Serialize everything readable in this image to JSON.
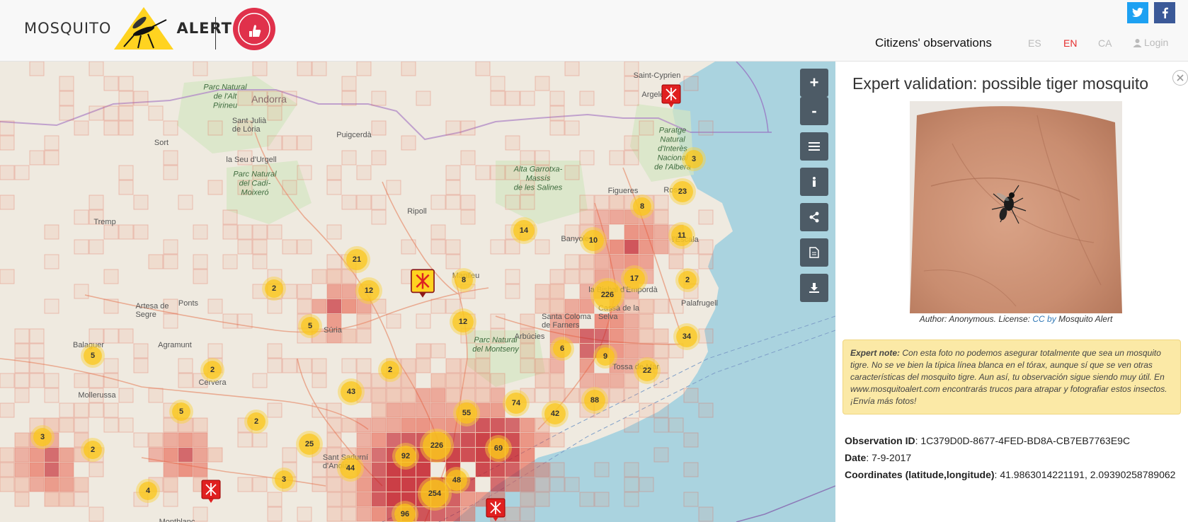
{
  "header": {
    "brand_left": "MOSQUITO",
    "brand_right": "ALERT",
    "nav_title": "Citizens' observations",
    "languages": [
      {
        "code": "ES",
        "active": false
      },
      {
        "code": "EN",
        "active": true
      },
      {
        "code": "CA",
        "active": false
      }
    ],
    "login": "Login",
    "social": {
      "twitter": "twitter-icon",
      "facebook": "facebook-icon"
    }
  },
  "map": {
    "controls": [
      "zoom-in",
      "zoom-out",
      "layers",
      "info",
      "share",
      "report",
      "download"
    ],
    "control_labels": {
      "zoom_in": "+",
      "zoom_out": "-"
    },
    "places": [
      {
        "text": "Andorra",
        "kind": "big"
      },
      {
        "text": "Sant Julià\nde Lòria",
        "kind": "town"
      },
      {
        "text": "Sort",
        "kind": "town"
      },
      {
        "text": "la Seu d'Urgell",
        "kind": "town"
      },
      {
        "text": "Puigcerdà",
        "kind": "town"
      },
      {
        "text": "Tremp",
        "kind": "town"
      },
      {
        "text": "Ripoll",
        "kind": "town"
      },
      {
        "text": "Banyoles",
        "kind": "town"
      },
      {
        "text": "Figueres",
        "kind": "town"
      },
      {
        "text": "Roses",
        "kind": "town"
      },
      {
        "text": "l'Escala",
        "kind": "town"
      },
      {
        "text": "Saint-Cyprien",
        "kind": "town"
      },
      {
        "text": "Argelès",
        "kind": "town"
      },
      {
        "text": "Manlleu",
        "kind": "town"
      },
      {
        "text": "Artesa de\nSegre",
        "kind": "town"
      },
      {
        "text": "Ponts",
        "kind": "town"
      },
      {
        "text": "Súria",
        "kind": "town"
      },
      {
        "text": "Agramunt",
        "kind": "town"
      },
      {
        "text": "Balaguer",
        "kind": "town"
      },
      {
        "text": "Mollerussa",
        "kind": "town"
      },
      {
        "text": "Cervera",
        "kind": "town"
      },
      {
        "text": "Arbúcies",
        "kind": "town"
      },
      {
        "text": "Santa Coloma\nde Farners",
        "kind": "town"
      },
      {
        "text": "la Bisbal d'Empordà",
        "kind": "town"
      },
      {
        "text": "Cassà de la\nSelva",
        "kind": "town"
      },
      {
        "text": "Palafrugell",
        "kind": "town"
      },
      {
        "text": "Tossa de Mar",
        "kind": "town"
      },
      {
        "text": "Sant Sadurní\nd'Anoia",
        "kind": "town"
      },
      {
        "text": "Montblanc",
        "kind": "town"
      },
      {
        "text": "Parc Natural\nde l'Alt\nPirineu",
        "kind": "park"
      },
      {
        "text": "Parc Natural\ndel Cadí-\nMoixeró",
        "kind": "park"
      },
      {
        "text": "Alta Garrotxa-\nMassís\nde les Salines",
        "kind": "park"
      },
      {
        "text": "Paratge\nNatural\nd'Interès\nNacional\nde l'Albera",
        "kind": "park"
      },
      {
        "text": "Parc Natural\ndel Montseny",
        "kind": "park"
      }
    ],
    "clusters": [
      "3",
      "23",
      "8",
      "11",
      "14",
      "10",
      "21",
      "2",
      "12",
      "8",
      "17",
      "2",
      "226",
      "5",
      "12",
      "34",
      "6",
      "9",
      "2",
      "22",
      "5",
      "2",
      "43",
      "88",
      "74",
      "42",
      "5",
      "55",
      "2",
      "3",
      "2",
      "25",
      "226",
      "92",
      "69",
      "44",
      "48",
      "3",
      "254",
      "4",
      "96"
    ]
  },
  "panel": {
    "title": "Expert validation: possible tiger mosquito",
    "credit_prefix": "Author: Anonymous. License: ",
    "credit_link": "CC by",
    "credit_suffix": " Mosquito Alert",
    "note_label": "Expert note:",
    "note_text": " Con esta foto no podemos asegurar totalmente que sea un mosquito tigre. No se ve bien la típica línea blanca en el tórax, aunque sí que se ven otras características del mosquito tigre. Aun así, tu observación sigue siendo muy útil. En www.mosquitoalert.com encontrarás trucos para atrapar y fotografiar estos insectos. ¡Envía más fotos!",
    "observation_label": "Observation ID",
    "observation_value": ": 1C379D0D-8677-4FED-BD8A-CB7EB7763E9C",
    "date_label": "Date",
    "date_value": ": 7-9-2017",
    "coords_label": "Coordinates (latitude,longitude)",
    "coords_value": ": 41.9863014221191, 2.09390258789062"
  }
}
